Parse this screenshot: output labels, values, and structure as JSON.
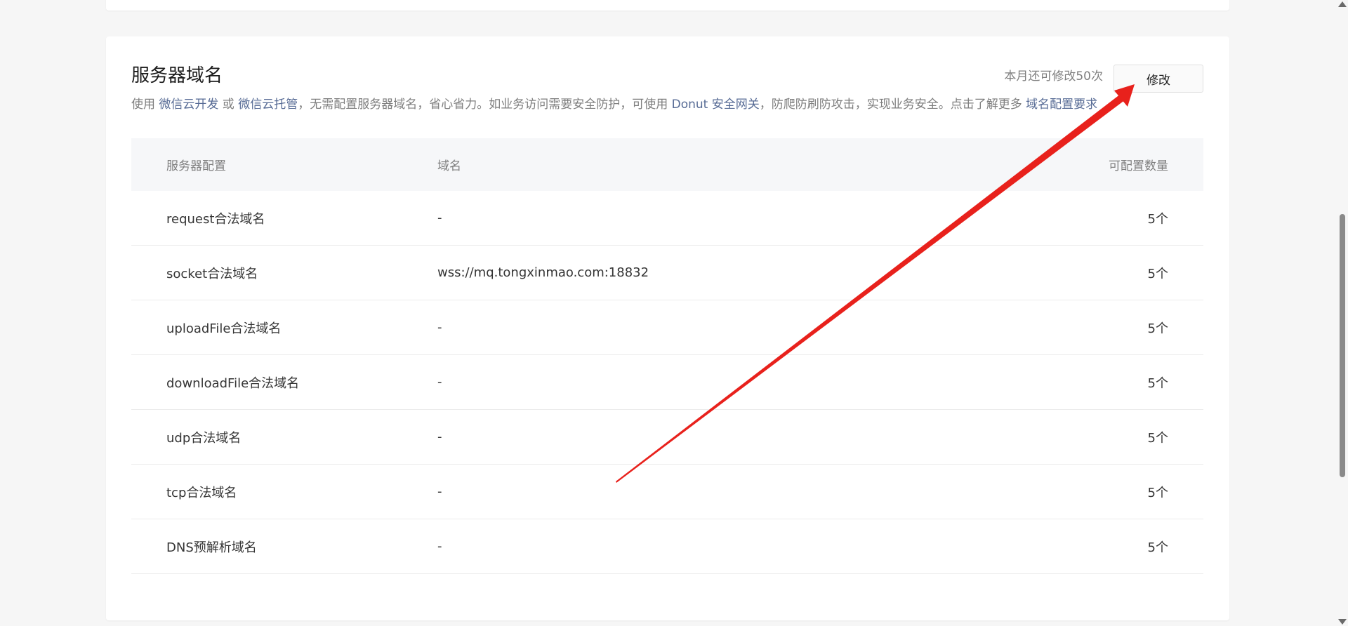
{
  "section": {
    "title": "服务器域名",
    "desc_parts": {
      "p1": "使用 ",
      "link1": "微信云开发",
      "p2": " 或 ",
      "link2": "微信云托管",
      "p3": "，无需配置服务器域名，省心省力。如业务访问需要安全防护，可使用 ",
      "link3": "Donut 安全网关",
      "p4": "，防爬防刷防攻击，实现业务安全。点击了解更多 ",
      "link4": "域名配置要求"
    },
    "quota_text": "本月还可修改50次",
    "modify_label": "修改"
  },
  "table": {
    "headers": [
      "服务器配置",
      "域名",
      "可配置数量"
    ],
    "rows": [
      {
        "type": "request合法域名",
        "domain": "-",
        "count": "5个"
      },
      {
        "type": "socket合法域名",
        "domain": "wss://mq.tongxinmao.com:18832",
        "count": "5个"
      },
      {
        "type": "uploadFile合法域名",
        "domain": "-",
        "count": "5个"
      },
      {
        "type": "downloadFile合法域名",
        "domain": "-",
        "count": "5个"
      },
      {
        "type": "udp合法域名",
        "domain": "-",
        "count": "5个"
      },
      {
        "type": "tcp合法域名",
        "domain": "-",
        "count": "5个"
      },
      {
        "type": "DNS预解析域名",
        "domain": "-",
        "count": "5个"
      }
    ]
  },
  "colors": {
    "link": "#576b95",
    "annotation_arrow": "#e8211c"
  }
}
